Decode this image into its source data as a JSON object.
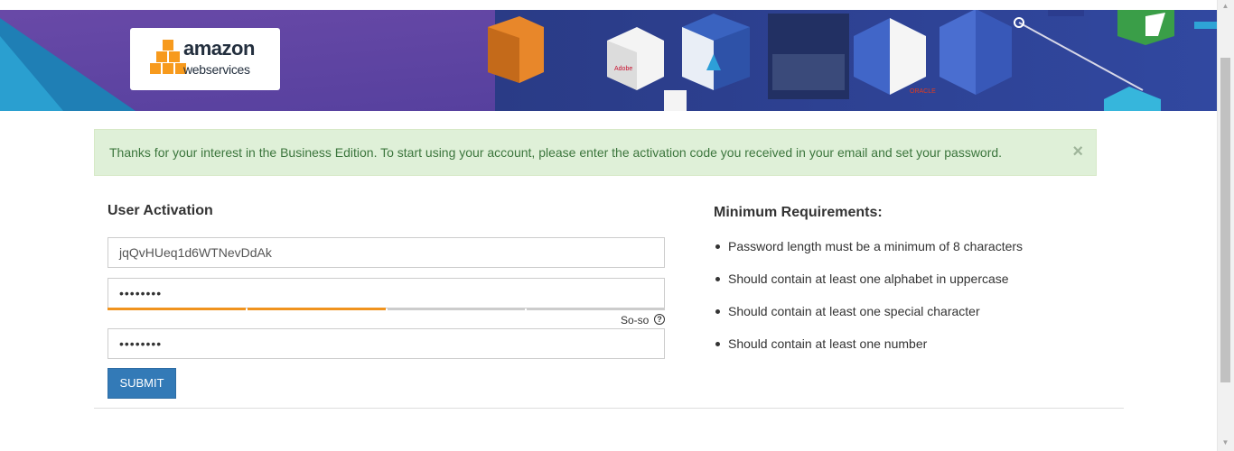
{
  "banner": {
    "logo": {
      "line1": "amazon",
      "line2": "webservices",
      "box_color": "#ff9900"
    },
    "tile_marks": {
      "adobe": "Adobe",
      "oracle": "ORACLE"
    }
  },
  "alert": {
    "message": "Thanks for your interest in the Business Edition. To start using your account, please enter the activation code you received in your email and set your password.",
    "close_label": "×",
    "color": "#3c763d"
  },
  "form": {
    "title": "User Activation",
    "activation_code_value": "jqQvHUeq1d6WTNevDdAk",
    "password_value": "••••••••",
    "confirm_password_value": "••••••••",
    "strength_label": "So-so",
    "strength_level": 0.5,
    "strength_color": "#f0931e",
    "help_icon": "?",
    "submit_label": "SUBMIT"
  },
  "requirements": {
    "title": "Minimum Requirements:",
    "items": [
      "Password length must be a minimum of 8 characters",
      "Should contain at least one alphabet in uppercase",
      "Should contain at least one special character",
      "Should contain at least one number"
    ]
  }
}
